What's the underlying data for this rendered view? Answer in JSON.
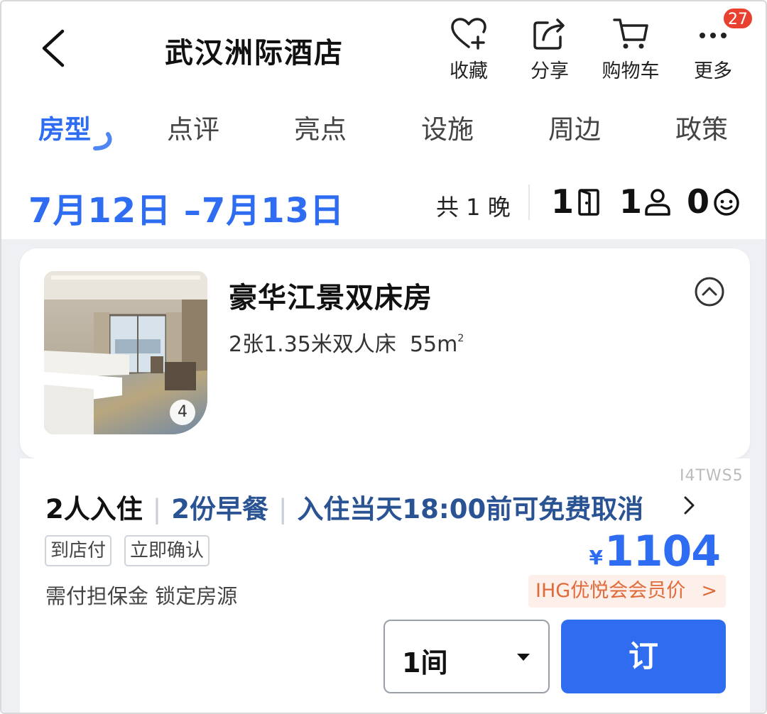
{
  "header": {
    "title": "武汉洲际酒店",
    "actions": [
      {
        "label": "收藏",
        "icon": "heart-plus-icon"
      },
      {
        "label": "分享",
        "icon": "share-icon"
      },
      {
        "label": "购物车",
        "icon": "cart-icon"
      },
      {
        "label": "更多",
        "icon": "more-icon"
      }
    ],
    "badge": "27"
  },
  "tabs": [
    "房型",
    "点评",
    "亮点",
    "设施",
    "周边",
    "政策"
  ],
  "active_tab": "房型",
  "stay": {
    "dates": "7月12日 –7月13日",
    "nights": "共 1 晚",
    "rooms": "1",
    "adults": "1",
    "children": "0"
  },
  "room": {
    "name": "豪华江景双床房",
    "beds": "2张1.35米双人床",
    "area_value": "55m",
    "area_sup": "2",
    "photo_count": "4"
  },
  "rate": {
    "code": "I4TWS5",
    "occupancy": "2人入住",
    "breakfast": "2份早餐",
    "cancellation": "入住当天18:00前可免费取消",
    "tags": [
      "到店付",
      "立即确认"
    ],
    "note": "需付担保金 锁定房源",
    "currency": "¥",
    "price": "1104",
    "member_label": "IHG优悦会会员价",
    "member_chevron": ">",
    "quantity": "1间",
    "book_label": "订"
  },
  "colors": {
    "accent": "#2e6cf2",
    "policy_text": "#2a5394",
    "badge": "#e8412f",
    "member_bg": "#fdf0ea",
    "member_text": "#e06a3a",
    "background_gray": "#eef0f4"
  }
}
